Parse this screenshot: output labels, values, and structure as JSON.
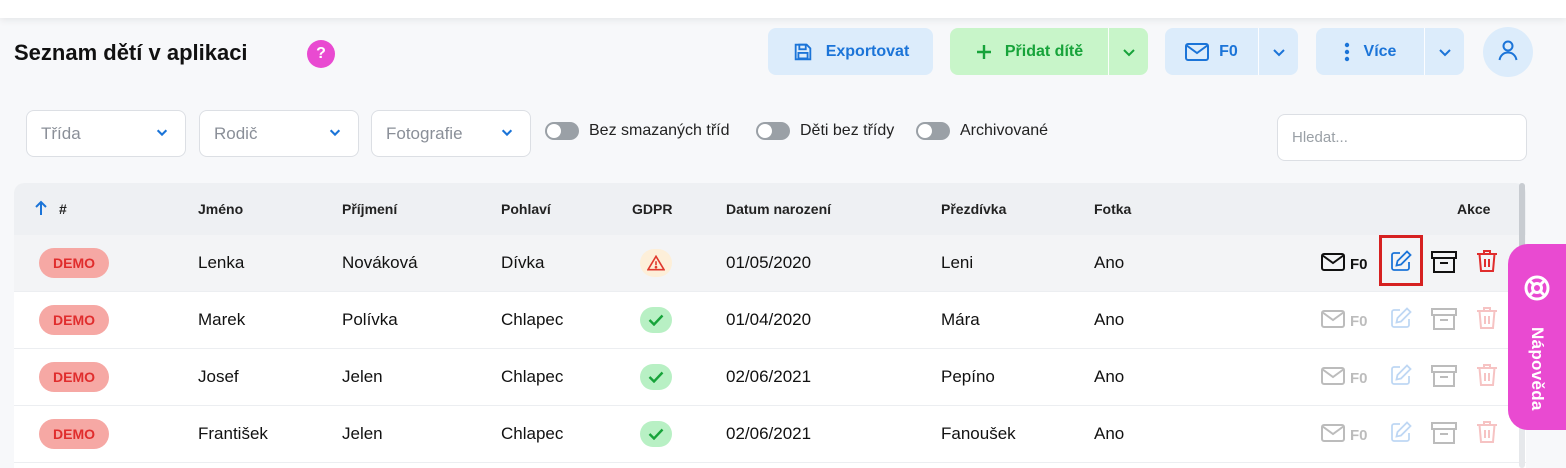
{
  "header": {
    "title": "Seznam dětí v aplikaci",
    "help_glyph": "?",
    "export_label": "Exportovat",
    "add_child_label": "Přidat dítě",
    "mail_label": "F0",
    "more_label": "Více"
  },
  "filters": {
    "class_placeholder": "Třída",
    "parent_placeholder": "Rodič",
    "photo_placeholder": "Fotografie",
    "toggle_no_deleted_classes": "Bez smazaných tříd",
    "toggle_children_without_class": "Děti bez třídy",
    "toggle_archived": "Archivované",
    "search_placeholder": "Hledat..."
  },
  "table": {
    "columns": {
      "index": "#",
      "first_name": "Jméno",
      "last_name": "Příjmení",
      "gender": "Pohlaví",
      "gdpr": "GDPR",
      "birth_date": "Datum narození",
      "nickname": "Přezdívka",
      "photo": "Fotka",
      "actions": "Akce"
    },
    "rows": [
      {
        "badge": "DEMO",
        "first_name": "Lenka",
        "last_name": "Nováková",
        "gender": "Dívka",
        "gdpr": "warning",
        "birth_date": "01/05/2020",
        "nickname": "Leni",
        "photo": "Ano",
        "mail_label": "F0"
      },
      {
        "badge": "DEMO",
        "first_name": "Marek",
        "last_name": "Polívka",
        "gender": "Chlapec",
        "gdpr": "ok",
        "birth_date": "01/04/2020",
        "nickname": "Mára",
        "photo": "Ano",
        "mail_label": "F0"
      },
      {
        "badge": "DEMO",
        "first_name": "Josef",
        "last_name": "Jelen",
        "gender": "Chlapec",
        "gdpr": "ok",
        "birth_date": "02/06/2021",
        "nickname": "Pepíno",
        "photo": "Ano",
        "mail_label": "F0"
      },
      {
        "badge": "DEMO",
        "first_name": "František",
        "last_name": "Jelen",
        "gender": "Chlapec",
        "gdpr": "ok",
        "birth_date": "02/06/2021",
        "nickname": "Fanoušek",
        "photo": "Ano",
        "mail_label": "F0"
      }
    ]
  },
  "help_tab": {
    "label": "Nápověda"
  },
  "colors": {
    "accent_blue": "#1b74d8",
    "accent_green": "#17a33a",
    "demo_red": "#e02d2d",
    "help_pink": "#e94ad1",
    "highlight_red": "#d62121"
  },
  "icons": [
    "help-icon",
    "save-icon",
    "plus-icon",
    "chevron-down-icon",
    "mail-icon",
    "more-vertical-icon",
    "user-icon",
    "sort-up-icon",
    "warning-icon",
    "check-icon",
    "edit-icon",
    "archive-icon",
    "trash-icon",
    "lifebuoy-icon"
  ]
}
